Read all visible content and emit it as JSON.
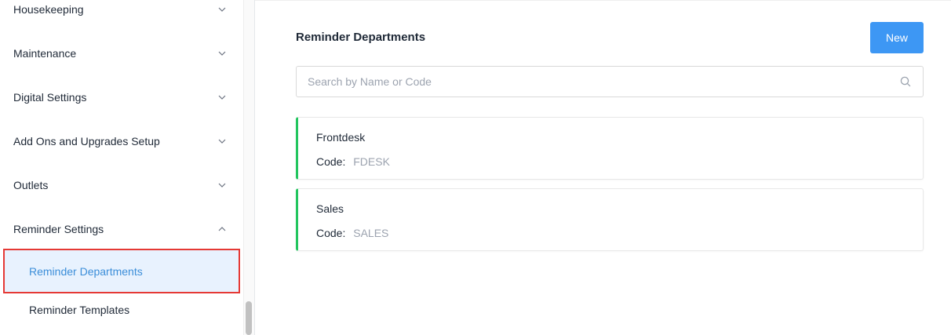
{
  "sidebar": {
    "groups": [
      {
        "label": "Housekeeping",
        "expanded": false
      },
      {
        "label": "Maintenance",
        "expanded": false
      },
      {
        "label": "Digital Settings",
        "expanded": false
      },
      {
        "label": "Add Ons and Upgrades Setup",
        "expanded": false
      },
      {
        "label": "Outlets",
        "expanded": false
      },
      {
        "label": "Reminder Settings",
        "expanded": true
      }
    ],
    "sub_items": [
      {
        "label": "Reminder Departments",
        "active": true
      },
      {
        "label": "Reminder Templates",
        "active": false
      }
    ]
  },
  "main": {
    "title": "Reminder Departments",
    "new_label": "New",
    "search": {
      "placeholder": "Search by Name or Code",
      "value": ""
    },
    "departments": [
      {
        "name": "Frontdesk",
        "code_label": "Code:",
        "code": "FDESK"
      },
      {
        "name": "Sales",
        "code_label": "Code:",
        "code": "SALES"
      }
    ]
  },
  "colors": {
    "accent": "#3d97f4",
    "active_bg": "#e8f2fe",
    "active_text": "#3b8ed9",
    "highlight_border": "#e53935",
    "card_accent": "#22c55e"
  },
  "icons": {
    "collapsed": "chevron-down-icon",
    "expanded": "chevron-up-icon",
    "search": "search-icon"
  }
}
